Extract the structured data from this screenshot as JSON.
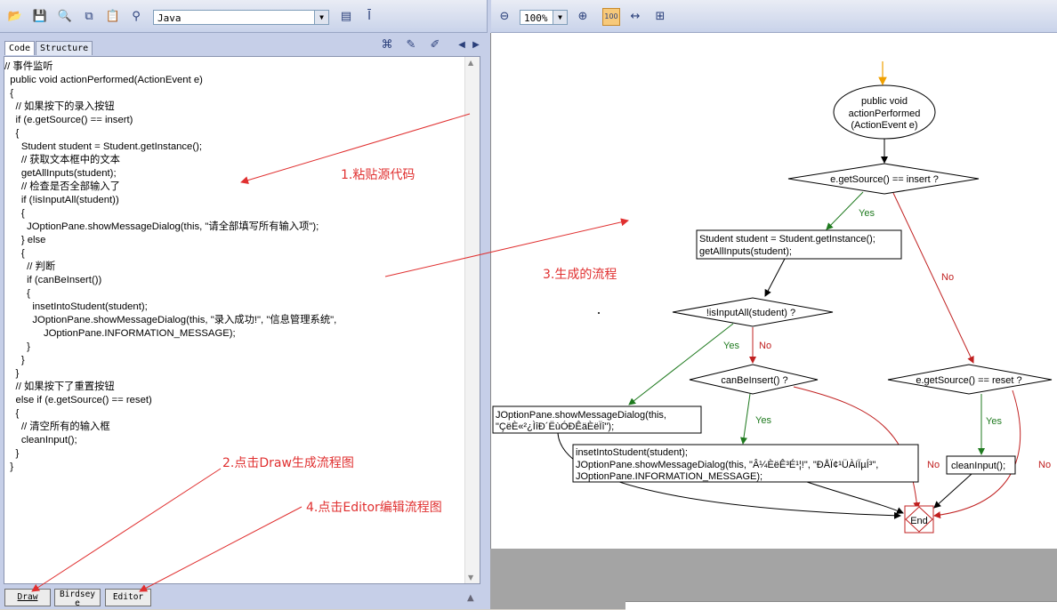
{
  "toolbar_left": {
    "language": "Java",
    "icons": [
      "open-folder-icon",
      "save-icon",
      "print-preview-icon",
      "copy-icon",
      "paste-icon",
      "find-icon"
    ],
    "right_icons": [
      "format-icon",
      "text-cursor-icon"
    ]
  },
  "toolbar_right": {
    "zoom": "100%",
    "icons": [
      "zoom-out-icon",
      "zoom-in-icon",
      "actual-size-icon",
      "fit-width-icon",
      "fit-page-icon"
    ]
  },
  "tabs": {
    "code": "Code",
    "structure": "Structure"
  },
  "code_lines": [
    "// 事件监听",
    "  public void actionPerformed(ActionEvent e)",
    "  {",
    "    // 如果按下的录入按钮",
    "    if (e.getSource() == insert)",
    "    {",
    "      Student student = Student.getInstance();",
    "      // 获取文本框中的文本",
    "      getAllInputs(student);",
    "      // 检查是否全部输入了",
    "      if (!isInputAll(student))",
    "      {",
    "        JOptionPane.showMessageDialog(this, \"请全部填写所有输入项\");",
    "      } else",
    "      {",
    "        // 判断",
    "        if (canBeInsert())",
    "        {",
    "          insetIntoStudent(student);",
    "          JOptionPane.showMessageDialog(this, \"录入成功!\", \"信息管理系统\",",
    "              JOptionPane.INFORMATION_MESSAGE);",
    "        }",
    "      }",
    "    }",
    "    // 如果按下了重置按钮",
    "    else if (e.getSource() == reset)",
    "    {",
    "      // 清空所有的输入框",
    "      cleanInput();",
    "    }",
    "  }"
  ],
  "annotations": {
    "step1": "1.粘贴源代码",
    "step2": "2.点击Draw生成流程图",
    "step3": "3.生成的流程",
    "step4": "4.点击Editor编辑流程图"
  },
  "buttons": {
    "draw": "Draw",
    "birdseye_1": "Birdsey",
    "birdseye_2": "e",
    "editor": "Editor"
  },
  "flowchart": {
    "start_1": "public void",
    "start_2": "actionPerformed",
    "start_3": "(ActionEvent e)",
    "d1": "e.getSource() == insert ?",
    "p1_1": "Student student = Student.getInstance();",
    "p1_2": "getAllInputs(student);",
    "d2": "!isInputAll(student) ?",
    "d3": "canBeInsert() ?",
    "d4": "e.getSource() == reset ?",
    "p2_1": "JOptionPane.showMessageDialog(this,",
    "p2_2": "\"ÇëÈ«²¿ÌîÐ´ËùÓÐÊäÈëÏî\");",
    "p3_1": "insetIntoStudent(student);",
    "p3_2": "JOptionPane.showMessageDialog(this, \"Â¼ÈëÊ³É¹¦!\", \"ÐÅÏ¢¹ÜÀíÏµÍ³\",",
    "p3_3": "JOptionPane.INFORMATION_MESSAGE);",
    "p4": "cleanInput();",
    "end": "End",
    "yes": "Yes",
    "no": "No"
  },
  "colors": {
    "annotation": "#e03030",
    "yes_line": "#1f7a1f",
    "no_line": "#c02020",
    "start_arrow": "#f0a000"
  }
}
